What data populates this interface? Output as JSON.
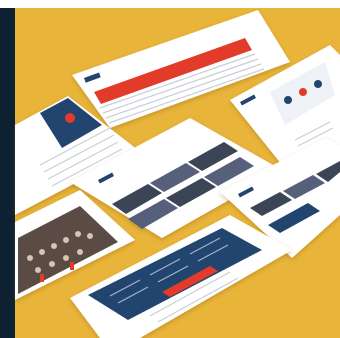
{
  "palette": {
    "background": "#e8b43a",
    "side_bar": "#0d2132",
    "card": "#ffffff",
    "navy": "#23456f",
    "red": "#e33b2c",
    "text_line": "#c9ced6",
    "photo_dark": "#3b4556"
  },
  "cards": [
    {
      "name": "card-top-table",
      "kind": "table",
      "has_red_band": true
    },
    {
      "name": "card-top-right-hero",
      "kind": "hero-illustration"
    },
    {
      "name": "card-left-article",
      "kind": "article-with-hero"
    },
    {
      "name": "card-center-gallery",
      "kind": "video-gallery"
    },
    {
      "name": "card-right-gallery",
      "kind": "video-gallery"
    },
    {
      "name": "card-left-photo",
      "kind": "group-photo"
    },
    {
      "name": "card-bottom-navy",
      "kind": "navy-panel-with-red-button"
    }
  ]
}
